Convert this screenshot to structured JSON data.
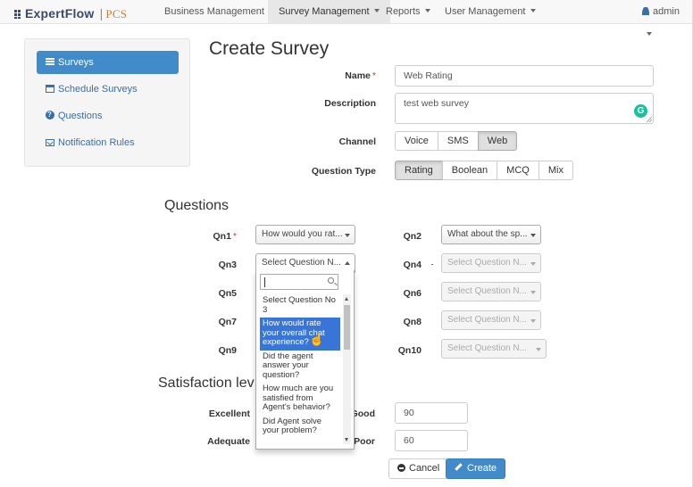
{
  "nav": {
    "brand": "ExpertFlow",
    "brand_sep": "|",
    "brand_suffix": "PCS",
    "items": [
      {
        "label": "Business Management"
      },
      {
        "label": "Survey Management"
      },
      {
        "label": "Reports"
      },
      {
        "label": "User Management"
      }
    ],
    "active_index": 1,
    "user": "admin"
  },
  "sidebar": {
    "items": [
      {
        "label": "Surveys",
        "icon": "list-icon",
        "active": true
      },
      {
        "label": "Schedule Surveys",
        "icon": "calendar-icon"
      },
      {
        "label": "Questions",
        "icon": "question-circle-icon"
      },
      {
        "label": "Notification Rules",
        "icon": "envelope-icon"
      }
    ]
  },
  "page": {
    "title": "Create Survey"
  },
  "form": {
    "name_label": "Name",
    "required_mark": "*",
    "name_value": "Web Rating",
    "description_label": "Description",
    "description_value": "test web survey",
    "grammarly_glyph": "G",
    "channel_label": "Channel",
    "channel_options": [
      "Voice",
      "SMS",
      "Web"
    ],
    "channel_selected": "Web",
    "question_type_label": "Question Type",
    "question_type_options": [
      "Rating",
      "Boolean",
      "MCQ",
      "Mix"
    ],
    "question_type_selected": "Rating"
  },
  "questions": {
    "heading": "Questions",
    "slots": [
      {
        "label": "Qn1",
        "required": true,
        "value": "How would you rat..."
      },
      {
        "label": "Qn2",
        "value": "What about the sp..."
      },
      {
        "label": "Qn3",
        "value": "Select Question N...",
        "open": true
      },
      {
        "label": "Qn4",
        "value": "Select Question N...",
        "disabled": true
      },
      {
        "label": "Qn5",
        "value": ""
      },
      {
        "label": "Qn6",
        "value": "Select Question N...",
        "disabled": true
      },
      {
        "label": "Qn7",
        "value": ""
      },
      {
        "label": "Qn8",
        "value": "Select Question N...",
        "disabled": true
      },
      {
        "label": "Qn9",
        "value": ""
      },
      {
        "label": "Qn10",
        "value": "Select Question N...",
        "disabled": true
      }
    ],
    "dropdown": {
      "search_value": "",
      "options": [
        "Select Question No 3",
        "How would rate your overall chat experience?",
        "Did the agent answer your question?",
        "How much are you satisfied from Agent's behavior?",
        "Did Agent solve your problem?"
      ],
      "highlighted_index": 1
    }
  },
  "satisfaction": {
    "heading": "Satisfaction lev",
    "excellent_label": "Excellent",
    "good_label": "Good",
    "good_value": "90",
    "adequate_label": "Adequate",
    "poor_label": "Poor",
    "poor_value": "60"
  },
  "actions": {
    "cancel_label": "Cancel",
    "create_label": "Create"
  }
}
